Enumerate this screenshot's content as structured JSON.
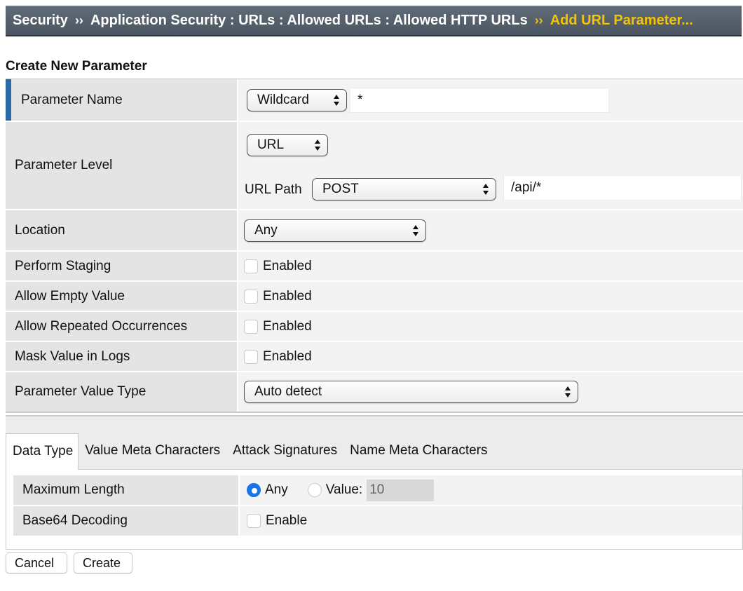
{
  "breadcrumb": {
    "items": [
      "Security",
      "Application Security : URLs : Allowed URLs : Allowed HTTP URLs"
    ],
    "current": "Add URL Parameter...",
    "separator": "››"
  },
  "form": {
    "title": "Create New Parameter",
    "rows": {
      "parameter_name": {
        "label": "Parameter Name",
        "select": "Wildcard",
        "value": "*"
      },
      "parameter_level": {
        "label": "Parameter Level",
        "select": "URL",
        "url_path_label": "URL Path",
        "url_method": "POST",
        "url_value": "/api/*"
      },
      "location": {
        "label": "Location",
        "select": "Any"
      },
      "perform_staging": {
        "label": "Perform Staging",
        "checkbox_label": "Enabled"
      },
      "allow_empty_value": {
        "label": "Allow Empty Value",
        "checkbox_label": "Enabled"
      },
      "allow_repeated": {
        "label": "Allow Repeated Occurrences",
        "checkbox_label": "Enabled"
      },
      "mask_value": {
        "label": "Mask Value in Logs",
        "checkbox_label": "Enabled"
      },
      "value_type": {
        "label": "Parameter Value Type",
        "select": "Auto detect"
      }
    }
  },
  "tabs": [
    "Data Type",
    "Value Meta Characters",
    "Attack Signatures",
    "Name Meta Characters"
  ],
  "data_type": {
    "max_length": {
      "label": "Maximum Length",
      "any_label": "Any",
      "value_label": "Value:",
      "value": "10"
    },
    "base64": {
      "label": "Base64 Decoding",
      "checkbox_label": "Enable"
    }
  },
  "buttons": {
    "cancel": "Cancel",
    "create": "Create"
  },
  "colors": {
    "accent": "#2c6aa8",
    "breadcrumb_active": "#f5c400",
    "radio_on": "#1a73e8"
  }
}
